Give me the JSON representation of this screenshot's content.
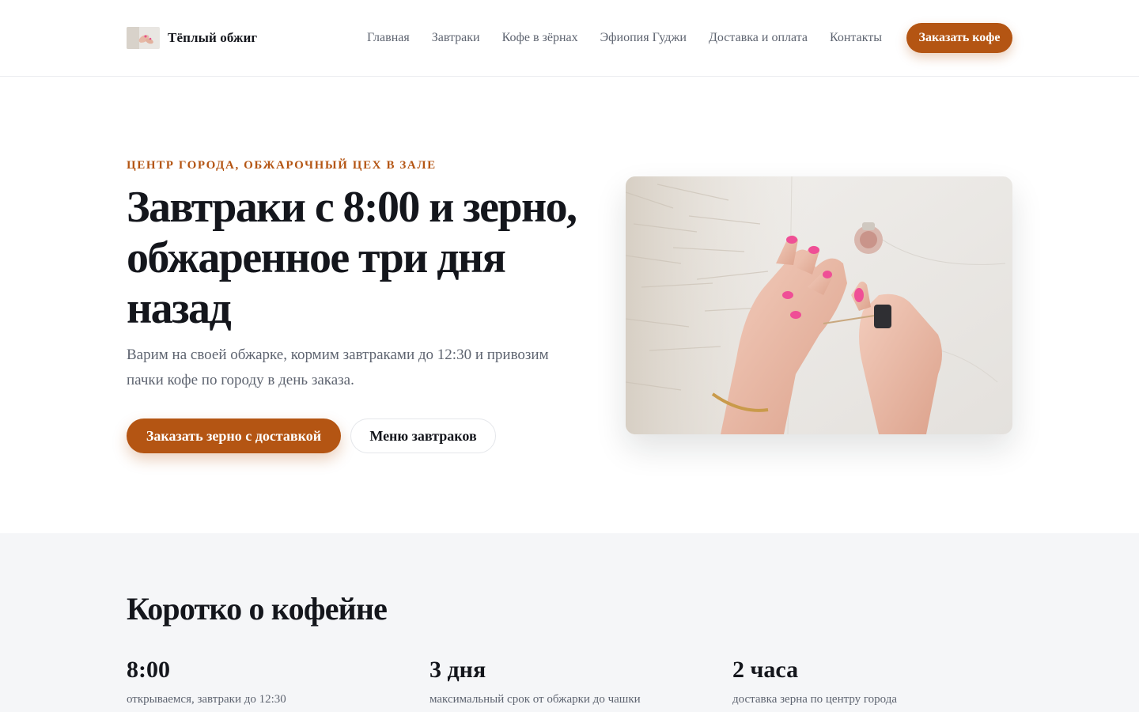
{
  "colors": {
    "accent": "#b45513",
    "text": "#14161c",
    "muted": "#5e6470",
    "section_bg": "#f5f6f8"
  },
  "header": {
    "brand": "Тёплый обжиг",
    "nav": [
      "Главная",
      "Завтраки",
      "Кофе в зёрнах",
      "Эфиопия Гуджи",
      "Доставка и оплата",
      "Контакты"
    ],
    "cta": "Заказать кофе"
  },
  "hero": {
    "eyebrow": "Центр города, обжарочный цех в зале",
    "title": "Завтраки с 8:00 и зерно, обжаренное три дня назад",
    "lead": "Варим на своей обжарке, кормим завтраками до 12:30 и привозим пачки кофе по городу в день заказа.",
    "primary_button": "Заказать зерно с доставкой",
    "secondary_button": "Меню завтраков"
  },
  "stats": {
    "title": "Коротко о кофейне",
    "items": [
      {
        "value": "8:00",
        "caption": "открываемся, завтраки до 12:30"
      },
      {
        "value": "3 дня",
        "caption": "максимальный срок от обжарки до чашки"
      },
      {
        "value": "2 часа",
        "caption": "доставка зерна по центру города"
      }
    ]
  }
}
